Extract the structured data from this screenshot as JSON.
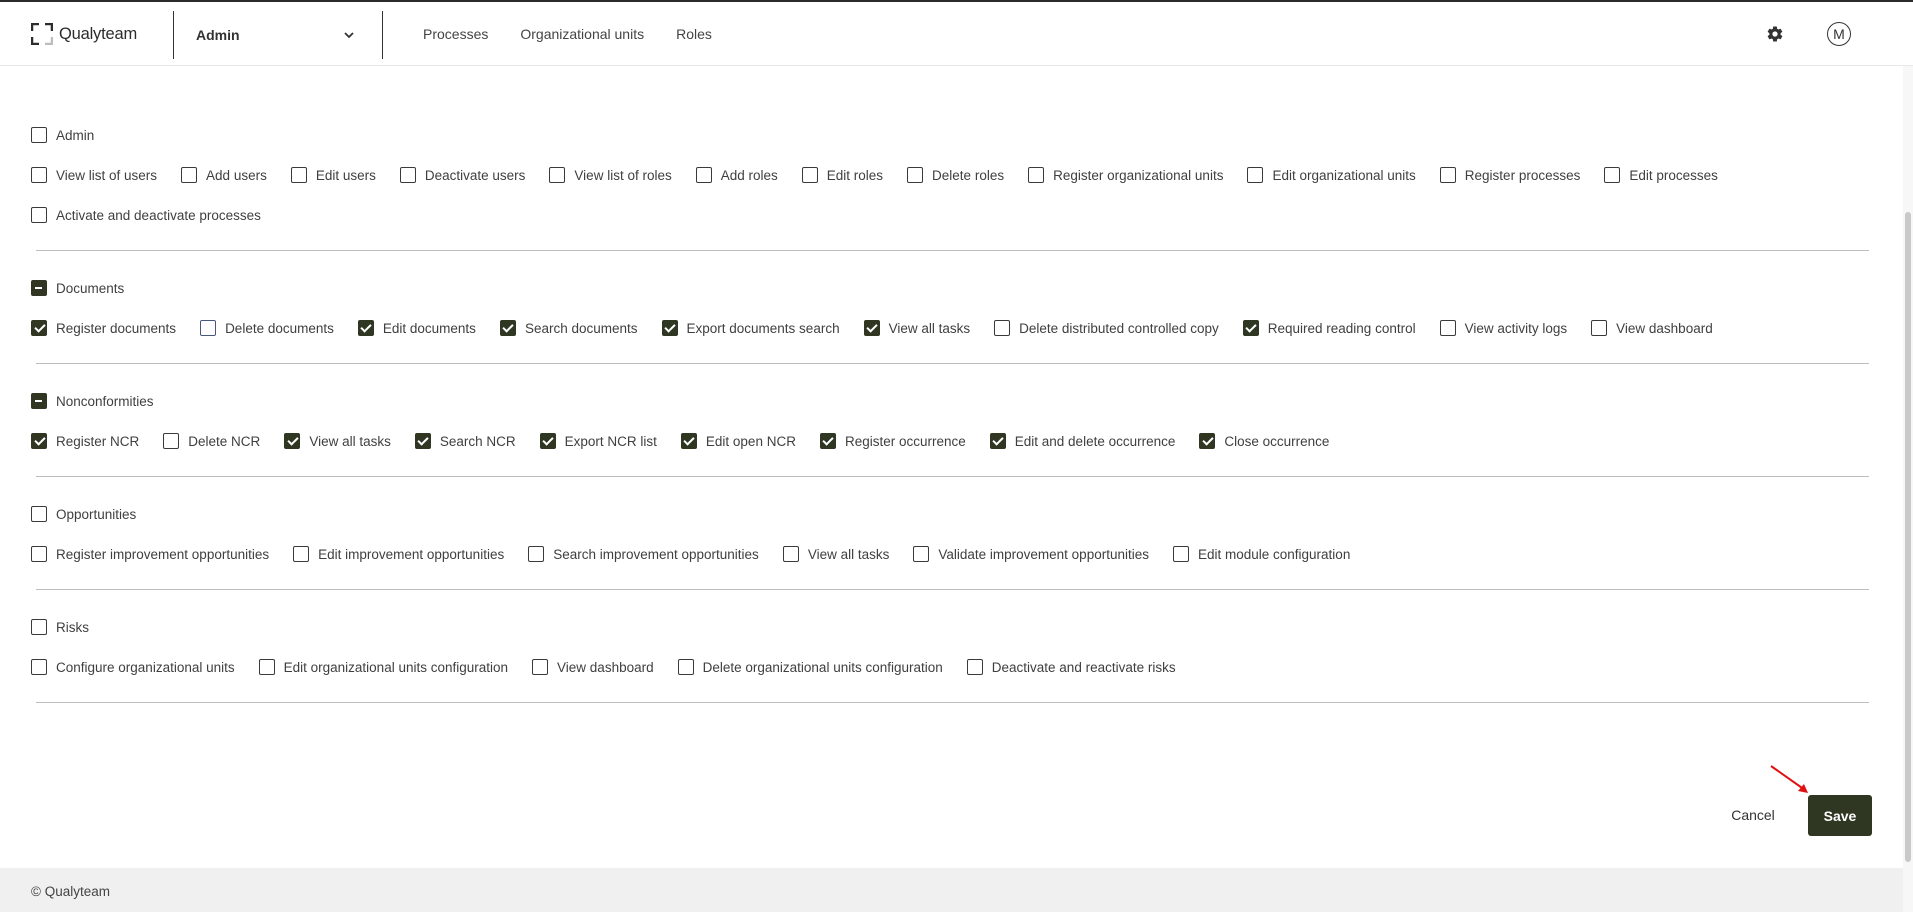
{
  "header": {
    "brand": "Qualyteam",
    "module": "Admin",
    "nav": [
      "Processes",
      "Organizational units",
      "Roles"
    ],
    "avatar_initial": "M",
    "icons": {
      "settings": "gear-icon",
      "module_toggle": "chevron-down-icon"
    }
  },
  "groups": [
    {
      "label": "Admin",
      "state": "unchecked",
      "permissions": [
        {
          "label": "View list of users",
          "checked": false
        },
        {
          "label": "Add users",
          "checked": false
        },
        {
          "label": "Edit users",
          "checked": false
        },
        {
          "label": "Deactivate users",
          "checked": false
        },
        {
          "label": "View list of roles",
          "checked": false
        },
        {
          "label": "Add roles",
          "checked": false
        },
        {
          "label": "Edit roles",
          "checked": false
        },
        {
          "label": "Delete roles",
          "checked": false
        },
        {
          "label": "Register organizational units",
          "checked": false
        },
        {
          "label": "Edit organizational units",
          "checked": false
        },
        {
          "label": "Register processes",
          "checked": false
        },
        {
          "label": "Edit processes",
          "checked": false
        },
        {
          "label": "Activate and deactivate processes",
          "checked": false
        }
      ]
    },
    {
      "label": "Documents",
      "state": "partial",
      "permissions": [
        {
          "label": "Register documents",
          "checked": true
        },
        {
          "label": "Delete documents",
          "checked": false,
          "focused": true
        },
        {
          "label": "Edit documents",
          "checked": true
        },
        {
          "label": "Search documents",
          "checked": true
        },
        {
          "label": "Export documents search",
          "checked": true
        },
        {
          "label": "View all tasks",
          "checked": true
        },
        {
          "label": "Delete distributed controlled copy",
          "checked": false
        },
        {
          "label": "Required reading control",
          "checked": true
        },
        {
          "label": "View activity logs",
          "checked": false
        },
        {
          "label": "View dashboard",
          "checked": false
        }
      ]
    },
    {
      "label": "Nonconformities",
      "state": "partial",
      "permissions": [
        {
          "label": "Register NCR",
          "checked": true
        },
        {
          "label": "Delete NCR",
          "checked": false
        },
        {
          "label": "View all tasks",
          "checked": true
        },
        {
          "label": "Search NCR",
          "checked": true
        },
        {
          "label": "Export NCR list",
          "checked": true
        },
        {
          "label": "Edit open NCR",
          "checked": true
        },
        {
          "label": "Register occurrence",
          "checked": true
        },
        {
          "label": "Edit and delete occurrence",
          "checked": true
        },
        {
          "label": "Close occurrence",
          "checked": true
        }
      ]
    },
    {
      "label": "Opportunities",
      "state": "unchecked",
      "permissions": [
        {
          "label": "Register improvement opportunities",
          "checked": false
        },
        {
          "label": "Edit improvement opportunities",
          "checked": false
        },
        {
          "label": "Search improvement opportunities",
          "checked": false
        },
        {
          "label": "View all tasks",
          "checked": false
        },
        {
          "label": "Validate improvement opportunities",
          "checked": false
        },
        {
          "label": "Edit module configuration",
          "checked": false
        }
      ]
    },
    {
      "label": "Risks",
      "state": "unchecked",
      "permissions": [
        {
          "label": "Configure organizational units",
          "checked": false
        },
        {
          "label": "Edit organizational units configuration",
          "checked": false
        },
        {
          "label": "View dashboard",
          "checked": false
        },
        {
          "label": "Delete organizational units configuration",
          "checked": false
        },
        {
          "label": "Deactivate and reactivate risks",
          "checked": false
        }
      ]
    }
  ],
  "actions": {
    "cancel": "Cancel",
    "save": "Save"
  },
  "footer": {
    "text": "© Qualyteam"
  },
  "colors": {
    "primary": "#2f3622",
    "annotation_arrow": "#e01010"
  }
}
